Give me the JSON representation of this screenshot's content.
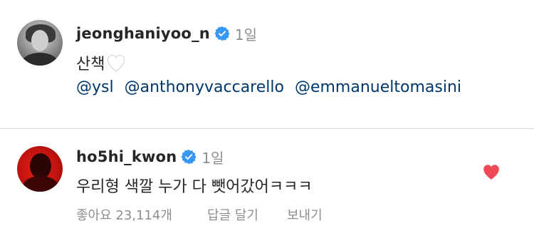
{
  "caption": {
    "username": "jeonghaniyoo_n",
    "time": "1일",
    "text": "산책",
    "text_icon": "white-heart-icon",
    "mentions": [
      "@ysl",
      "@anthonyvaccarello",
      "@emmanueltomasini"
    ]
  },
  "comment": {
    "username": "ho5hi_kwon",
    "time": "1일",
    "text": "우리형 색깔 누가 다 뺏어갔어ㅋㅋㅋ",
    "liked_icon": "red-heart-icon",
    "likes_label": "좋아요 23,114개",
    "reply_label": "답글 달기",
    "send_label": "보내기"
  },
  "colors": {
    "verified": "#3897f0",
    "liked_heart": "#ed4956",
    "mention": "#00376b",
    "secondary_text": "#8e8e8e"
  }
}
